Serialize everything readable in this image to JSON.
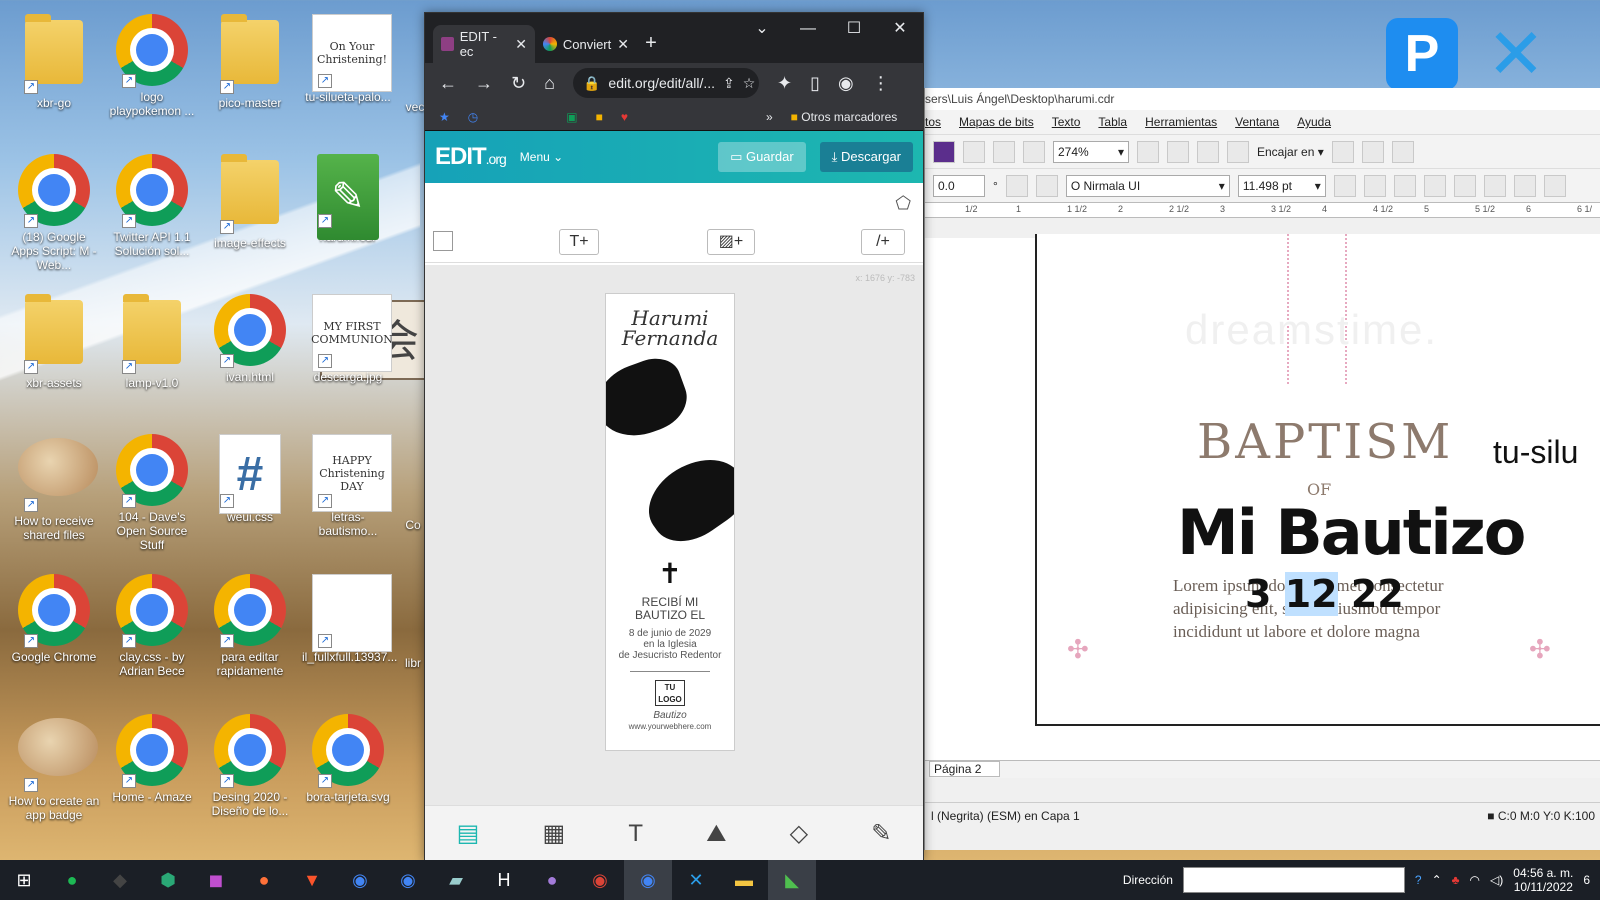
{
  "desktop": {
    "icons": [
      {
        "label": "xbr-go",
        "kind": "folder"
      },
      {
        "label": "logo playpokemon ...",
        "kind": "chrome"
      },
      {
        "label": "pico-master",
        "kind": "folder"
      },
      {
        "label": "tu-silueta-palo...",
        "kind": "thumb",
        "thumb_text": "On Your Christening!"
      },
      {
        "label": "(18) Google Apps Script: M - Web...",
        "kind": "chrome"
      },
      {
        "label": "Twitter API 1.1 Solución sol...",
        "kind": "chrome"
      },
      {
        "label": "image-effects",
        "kind": "folder"
      },
      {
        "label": "harumi.cdr",
        "kind": "cdr"
      },
      {
        "label": "xbr-assets",
        "kind": "folder"
      },
      {
        "label": "lamp-v1.0",
        "kind": "folder"
      },
      {
        "label": "ivan.html",
        "kind": "chrome"
      },
      {
        "label": "descarga.jpg",
        "kind": "thumb",
        "thumb_text": "MY FIRST COMMUNION"
      },
      {
        "label": "How to receive shared files",
        "kind": "puffer"
      },
      {
        "label": "104 - Dave's Open Source Stuff",
        "kind": "chrome"
      },
      {
        "label": "weui.css",
        "kind": "hash"
      },
      {
        "label": "letras-bautismo...",
        "kind": "thumb",
        "thumb_text": "HAPPY Christening DAY"
      },
      {
        "label": "Google Chrome",
        "kind": "chrome"
      },
      {
        "label": "clay.css - by Adrian Bece",
        "kind": "chrome"
      },
      {
        "label": "para editar rapidamente",
        "kind": "chrome"
      },
      {
        "label": "il_fullxfull.13937...",
        "kind": "thumb",
        "thumb_text": ""
      },
      {
        "label": "How to create an app badge",
        "kind": "puffer"
      },
      {
        "label": "Home - Amaze",
        "kind": "chrome"
      },
      {
        "label": "Desing 2020 - Diseño de lo...",
        "kind": "chrome"
      },
      {
        "label": "bora-tarjeta.svg",
        "kind": "chrome"
      }
    ],
    "partial_labels": [
      "vec",
      "Co",
      "libr"
    ],
    "sign_text": "士会"
  },
  "chrome": {
    "tabs": [
      {
        "title": "EDIT - ec",
        "favicon_color": "#8e3f83"
      },
      {
        "title": "Conviert",
        "favicon_color": "#e37400"
      }
    ],
    "new_tab": "+",
    "url": "edit.org/edit/all/...",
    "bookmarks_more": "»",
    "bookmarks_folder": "Otros marcadores"
  },
  "editorg": {
    "logo": "EDIT",
    "logo_suffix": ".org",
    "menu_label": "Menu",
    "save_label": "Guardar",
    "download_label": "Descargar",
    "coords": "x: 1676 y: -783",
    "design": {
      "name_line1": "Harumi",
      "name_line2": "Fernanda",
      "received_line1": "RECIBÍ MI",
      "received_line2": "BAUTIZO EL",
      "date_line": "8 de junio de 2029",
      "place_line1": "en la Iglesia",
      "place_line2": "de Jesucristo Redentor",
      "logo_line1": "TU",
      "logo_line2": "LOGO",
      "signature": "Bautizo",
      "website": "www.yourwebhere.com"
    }
  },
  "corel": {
    "path": "sers\\Luis Ángel\\Desktop\\harumi.cdr",
    "menu": [
      "tos",
      "Mapas de bits",
      "Texto",
      "Tabla",
      "Herramientas",
      "Ventana",
      "Ayuda"
    ],
    "zoom": "274%",
    "fit": "Encajar en",
    "angle": "0.0",
    "font": "Nirmala UI",
    "size": "11.498 pt",
    "ruler": [
      "1/2",
      "1",
      "1 1/2",
      "2",
      "2 1/2",
      "3",
      "3 1/2",
      "4",
      "4 1/2",
      "5",
      "5 1/2",
      "6",
      "6 1/"
    ],
    "canvas": {
      "watermark": "dreamstime.",
      "baptism": "BAPTISM",
      "of": "OF",
      "title": "Mi Bautizo",
      "lorem": "Lorem ipsum dolor sit amet consectetur adipisicing elit, sed do eiusmod tempor incididunt ut labore et dolore magna",
      "date_day": "3",
      "date_month": "12",
      "date_year": "22",
      "side_text": "tu-silu"
    },
    "page_tab": "Página 2",
    "status_left": "l (Negrita) (ESM) en Capa 1",
    "status_color": "C:0 M:0 Y:0 K:100"
  },
  "taskbar": {
    "direccion": "Dirección",
    "time": "04:56 a. m.",
    "date": "10/11/2022",
    "notifications": "6"
  }
}
